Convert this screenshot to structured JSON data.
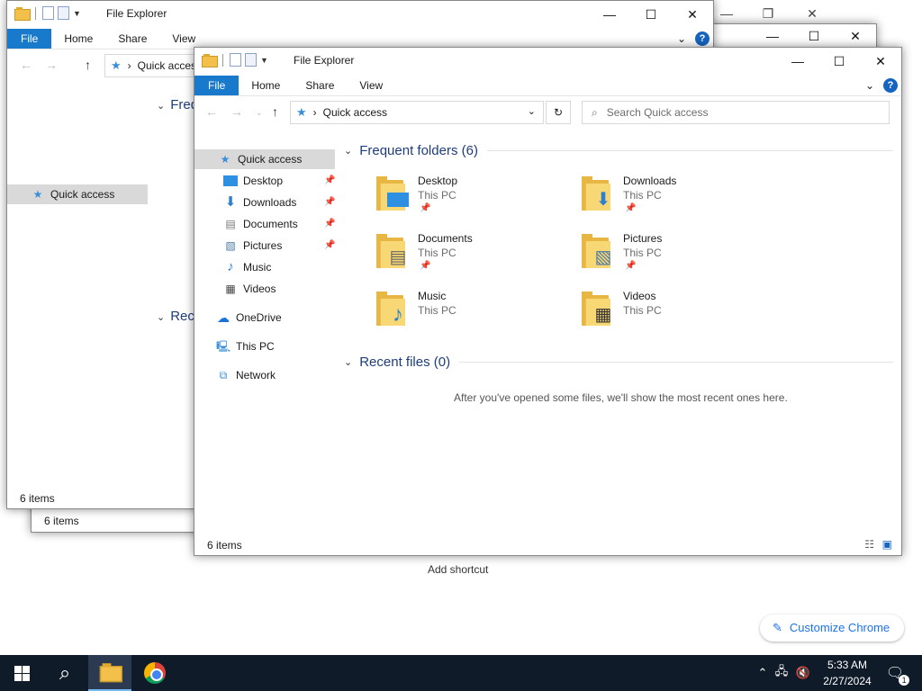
{
  "chrome": {
    "add_shortcut": "Add shortcut",
    "customize": "Customize Chrome"
  },
  "explorer": {
    "title": "File Explorer",
    "ribbon_tabs": [
      "File",
      "Home",
      "Share",
      "View"
    ],
    "address": "Quick access",
    "search_placeholder": "Search Quick access",
    "nav": {
      "quick_access": "Quick access",
      "items": [
        "Desktop",
        "Downloads",
        "Documents",
        "Pictures",
        "Music",
        "Videos"
      ],
      "onedrive": "OneDrive",
      "this_pc": "This PC",
      "network": "Network"
    },
    "frequent_header": "Frequent folders (6)",
    "frequent_header_short": "Frequ",
    "recent_header": "Recent files (0)",
    "recent_header_short": "Rec",
    "folders": [
      {
        "name": "Desktop",
        "location": "This PC",
        "pinned": true
      },
      {
        "name": "Downloads",
        "location": "This PC",
        "pinned": true
      },
      {
        "name": "Documents",
        "location": "This PC",
        "pinned": true
      },
      {
        "name": "Pictures",
        "location": "This PC",
        "pinned": true
      },
      {
        "name": "Music",
        "location": "This PC",
        "pinned": false
      },
      {
        "name": "Videos",
        "location": "This PC",
        "pinned": false
      }
    ],
    "empty_recent": "After you've opened some files, we'll show the most recent ones here.",
    "status": "6 items"
  },
  "taskbar": {
    "time": "5:33 AM",
    "date": "2/27/2024",
    "notifications": "1"
  },
  "colors": {
    "accent": "#1979ca",
    "taskbar": "#101b2a"
  }
}
